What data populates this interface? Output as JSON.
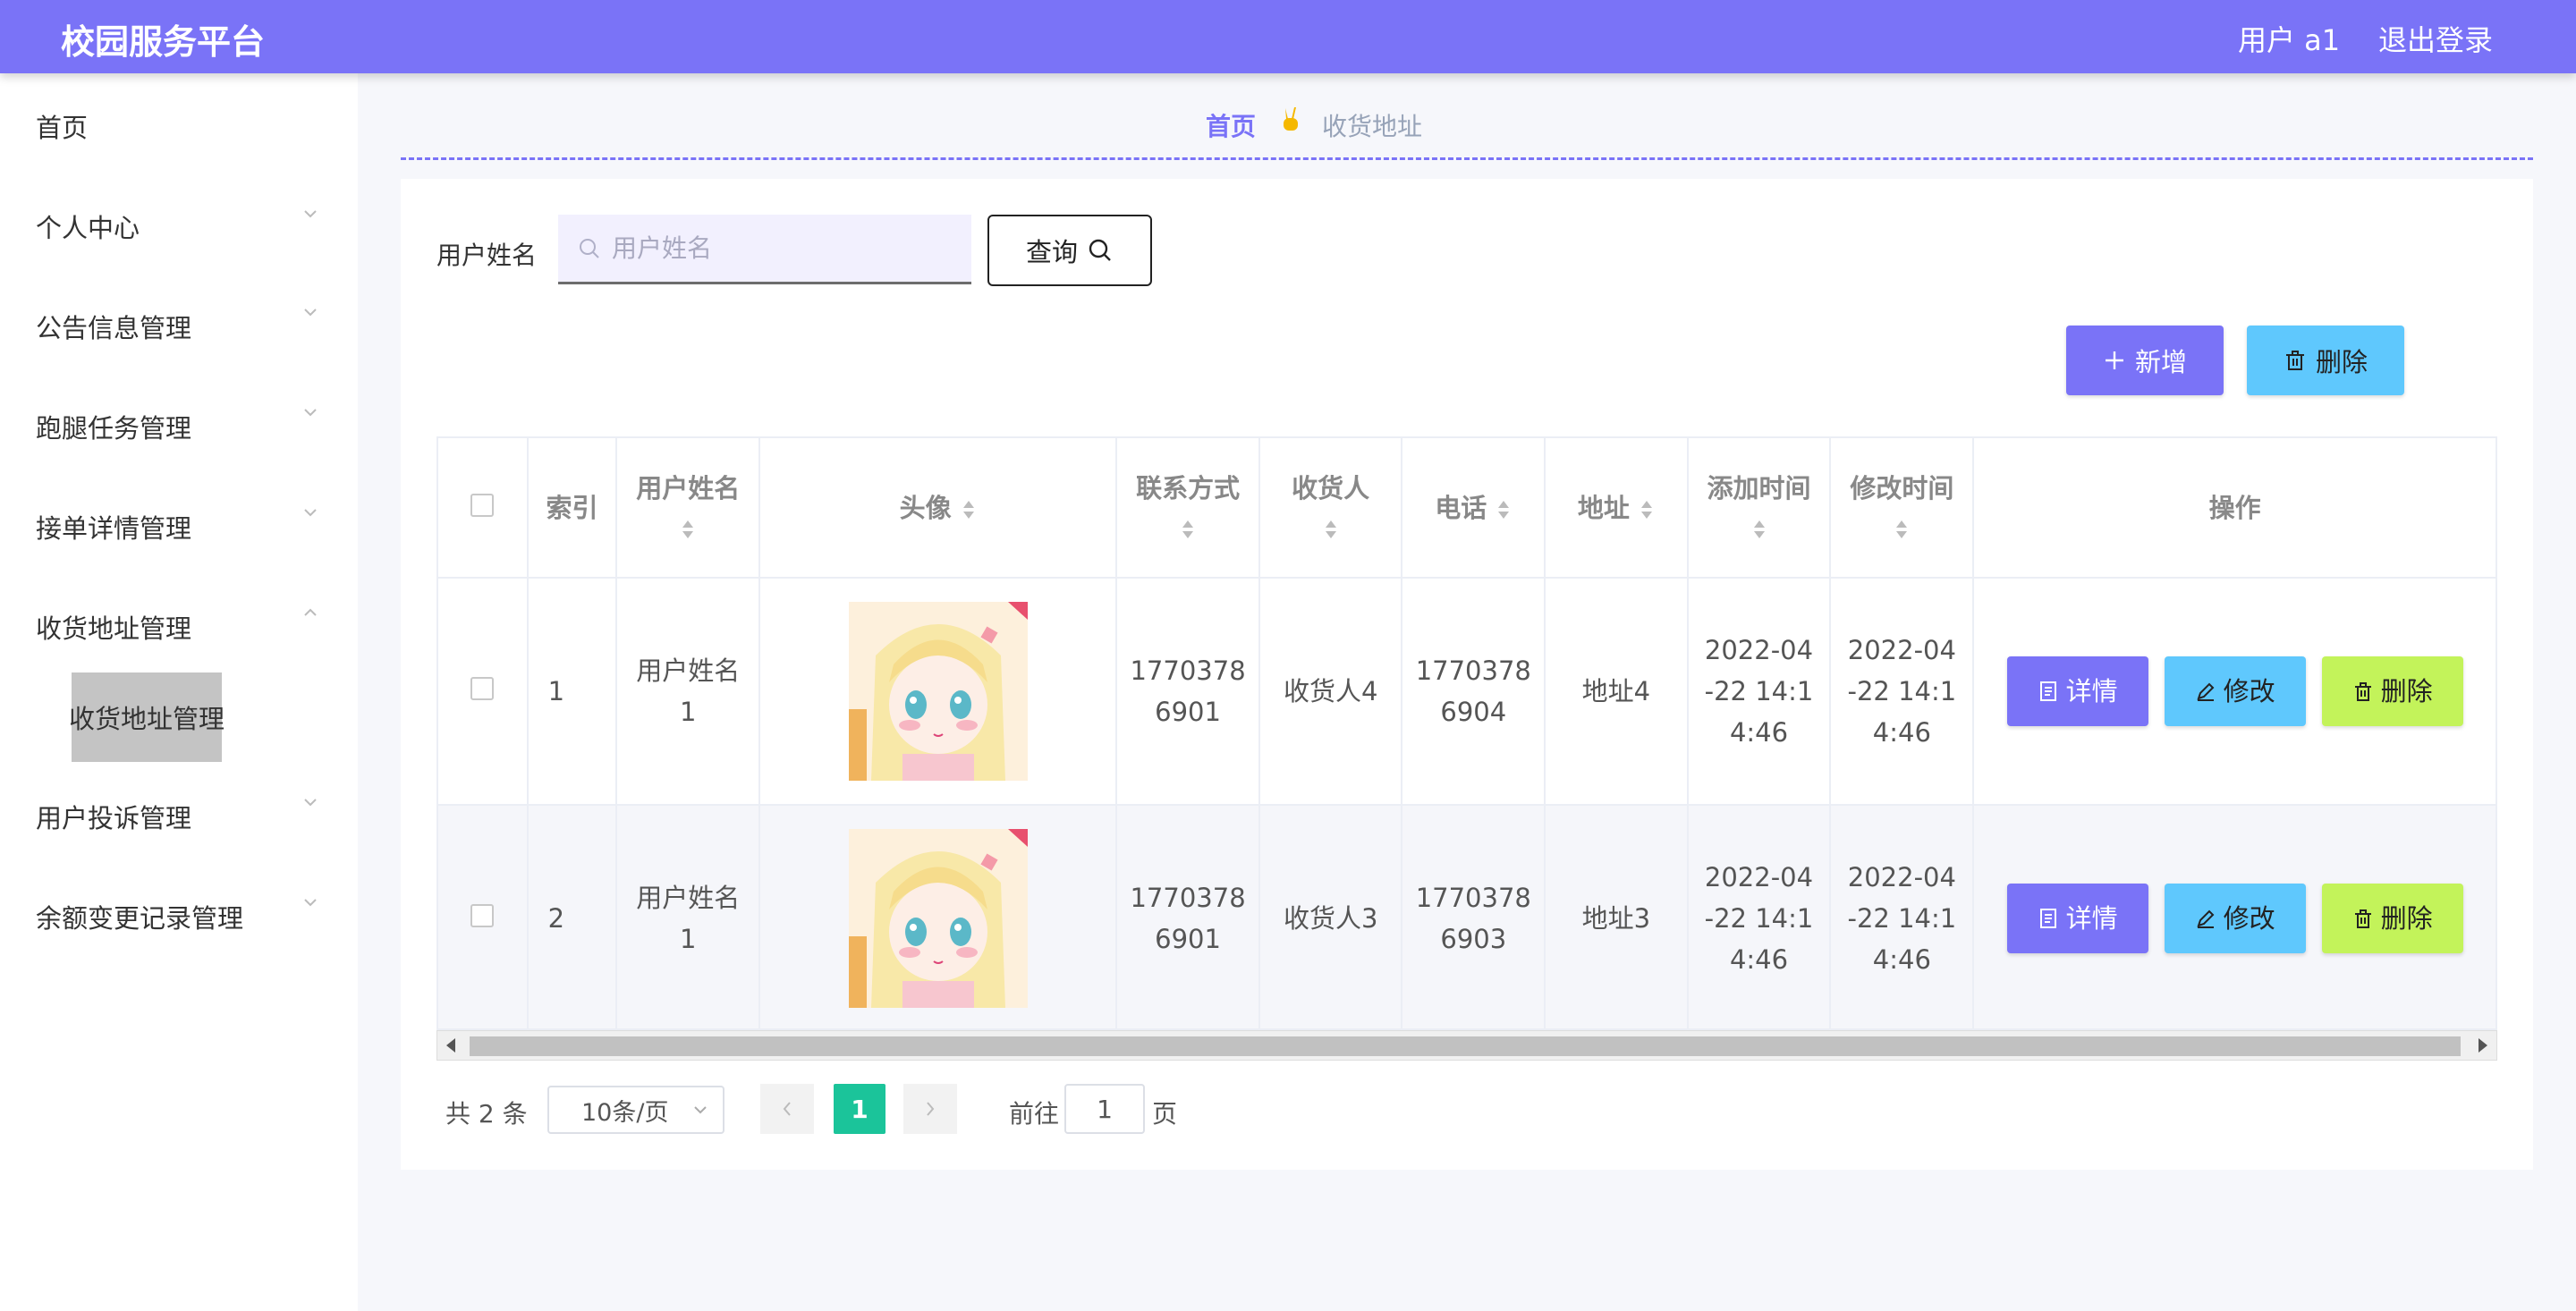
{
  "header": {
    "brand": "校园服务平台",
    "user_label": "用户 a1",
    "logout": "退出登录"
  },
  "sidebar": {
    "items": [
      {
        "label": "首页",
        "has_arrow": false
      },
      {
        "label": "个人中心",
        "has_arrow": true
      },
      {
        "label": "公告信息管理",
        "has_arrow": true
      },
      {
        "label": "跑腿任务管理",
        "has_arrow": true
      },
      {
        "label": "接单详情管理",
        "has_arrow": true
      },
      {
        "label": "收货地址管理",
        "has_arrow": true,
        "expanded": true
      },
      {
        "label": "用户投诉管理",
        "has_arrow": true
      },
      {
        "label": "余额变更记录管理",
        "has_arrow": true
      }
    ],
    "submenu_active": "收货地址管理"
  },
  "breadcrumb": {
    "home": "首页",
    "separator_icon": "victory-hand-emoji",
    "current": "收货地址"
  },
  "search": {
    "label": "用户姓名",
    "placeholder": "用户姓名",
    "value": "",
    "button": "查询"
  },
  "actions": {
    "add": "新增",
    "delete": "删除"
  },
  "table": {
    "columns": [
      "索引",
      "用户姓名",
      "头像",
      "联系方式",
      "收货人",
      "电话",
      "地址",
      "添加时间",
      "修改时间",
      "操作"
    ],
    "rows": [
      {
        "index": "1",
        "username": "用户姓名1",
        "avatar": "anime-girl-avatar",
        "contact": "17703786901",
        "receiver": "收货人4",
        "phone": "17703786904",
        "address": "地址4",
        "created": "2022-04-22 14:14:46",
        "modified": "2022-04-22 14:14:46"
      },
      {
        "index": "2",
        "username": "用户姓名1",
        "avatar": "anime-girl-avatar",
        "contact": "17703786901",
        "receiver": "收货人3",
        "phone": "17703786903",
        "address": "地址3",
        "created": "2022-04-22 14:14:46",
        "modified": "2022-04-22 14:14:46"
      }
    ],
    "row_buttons": {
      "detail": "详情",
      "edit": "修改",
      "delete": "删除"
    }
  },
  "pagination": {
    "total": "共 2 条",
    "page_size": "10条/页",
    "current_page": "1",
    "goto_label": "前往",
    "goto_value": "1",
    "goto_suffix": "页"
  },
  "colors": {
    "primary": "#7a73f7",
    "info": "#5fc8fd",
    "lime": "#c3f35a",
    "page_active": "#1bc49a"
  }
}
